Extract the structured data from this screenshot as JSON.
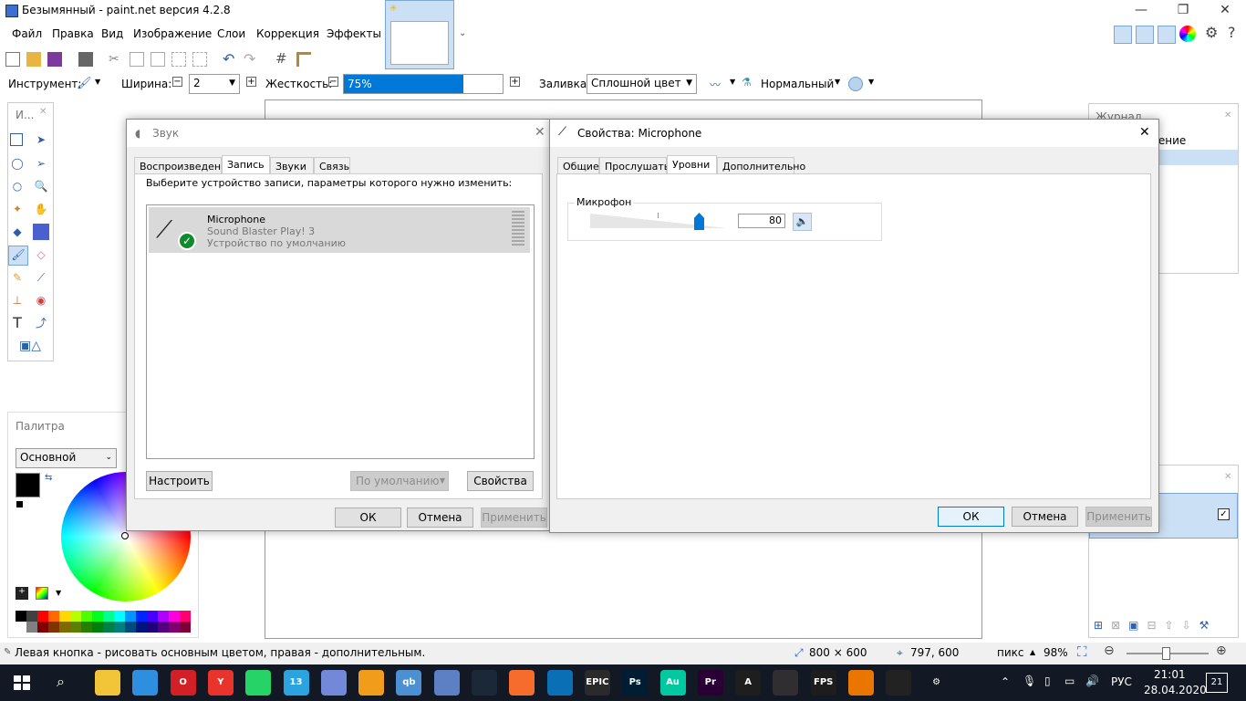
{
  "window": {
    "title": "Безымянный - paint.net версия 4.2.8",
    "minimize": "—",
    "maximize": "❐",
    "close": "✕"
  },
  "menu": [
    "Файл",
    "Правка",
    "Вид",
    "Изображение",
    "Слои",
    "Коррекция",
    "Эффекты"
  ],
  "toolbar": {
    "tool_label": "Инструмент:",
    "width_label": "Ширина:",
    "width_value": "2",
    "hardness_label": "Жесткость:",
    "hardness_value": "75%",
    "hardness_level": 0.75,
    "fill_label": "Заливка:",
    "fill_value": "Сплошной цвет",
    "blend_value": "Нормальный"
  },
  "tools_panel": {
    "title": "И..."
  },
  "palette": {
    "title": "Палитра",
    "mode": "Основной"
  },
  "journal": {
    "title": "Журнал",
    "item": "Изображение"
  },
  "status": {
    "hint": "Левая кнопка - рисовать основным цветом, правая - дополнительным.",
    "size": "800 × 600",
    "cursor": "797, 600",
    "units": "пикс",
    "zoom": "98%"
  },
  "sound_dialog": {
    "title": "Звук",
    "tabs": [
      "Воспроизведение",
      "Запись",
      "Звуки",
      "Связь"
    ],
    "instruction": "Выберите устройство записи, параметры которого нужно изменить:",
    "device": {
      "name": "Microphone",
      "model": "Sound Blaster Play! 3",
      "status": "Устройство по умолчанию"
    },
    "configure": "Настроить",
    "default": "По умолчанию",
    "properties": "Свойства",
    "ok": "ОК",
    "cancel": "Отмена",
    "apply": "Применить"
  },
  "mic_dialog": {
    "title": "Свойства: Microphone",
    "tabs": [
      "Общие",
      "Прослушать",
      "Уровни",
      "Дополнительно"
    ],
    "group_label": "Микрофон",
    "level": "80",
    "level_fraction": 0.8,
    "ok": "ОК",
    "cancel": "Отмена",
    "apply": "Применить"
  },
  "taskbar": {
    "apps": [
      {
        "name": "file-explorer",
        "label": "",
        "color": "#f2c438"
      },
      {
        "name": "control-panel",
        "label": "",
        "color": "#2e8ee0"
      },
      {
        "name": "opera",
        "label": "O",
        "color": "#d31f26"
      },
      {
        "name": "yandex",
        "label": "Y",
        "color": "#e8342a"
      },
      {
        "name": "whatsapp",
        "label": "",
        "color": "#25d366"
      },
      {
        "name": "telegram",
        "label": "13",
        "color": "#2aa3df"
      },
      {
        "name": "discord",
        "label": "",
        "color": "#7289da"
      },
      {
        "name": "aimp",
        "label": "",
        "color": "#f19c1a"
      },
      {
        "name": "qbittorrent",
        "label": "qb",
        "color": "#4c8fd3"
      },
      {
        "name": "paintnet",
        "label": "",
        "color": "#5d7fc4"
      },
      {
        "name": "steam",
        "label": "",
        "color": "#1b2838"
      },
      {
        "name": "origin",
        "label": "",
        "color": "#f56c2d"
      },
      {
        "name": "uplay",
        "label": "",
        "color": "#0b6fb6"
      },
      {
        "name": "epic-games",
        "label": "EPIC",
        "color": "#2a2a2a"
      },
      {
        "name": "photoshop",
        "label": "Ps",
        "color": "#001d34"
      },
      {
        "name": "audition",
        "label": "Au",
        "color": "#00c8a0"
      },
      {
        "name": "premiere",
        "label": "Pr",
        "color": "#2a0034"
      },
      {
        "name": "anydesk",
        "label": "A",
        "color": "#1e1e1e"
      },
      {
        "name": "obs",
        "label": "",
        "color": "#302e31"
      },
      {
        "name": "fps-monitor",
        "label": "FPS",
        "color": "#1d1d1d"
      },
      {
        "name": "blender",
        "label": "",
        "color": "#ea7600"
      },
      {
        "name": "audio-app",
        "label": "",
        "color": "#222222"
      },
      {
        "name": "settings",
        "label": "⚙",
        "color": "#121824"
      },
      {
        "name": "sound",
        "label": "",
        "color": "#3a4a5e"
      }
    ],
    "lang": "РУС",
    "time": "21:01",
    "date": "28.04.2020",
    "notifications": "21"
  },
  "colors": {
    "accent": "#0078d7",
    "primary_color": "#000000",
    "secondary_color": "#ffffff"
  }
}
